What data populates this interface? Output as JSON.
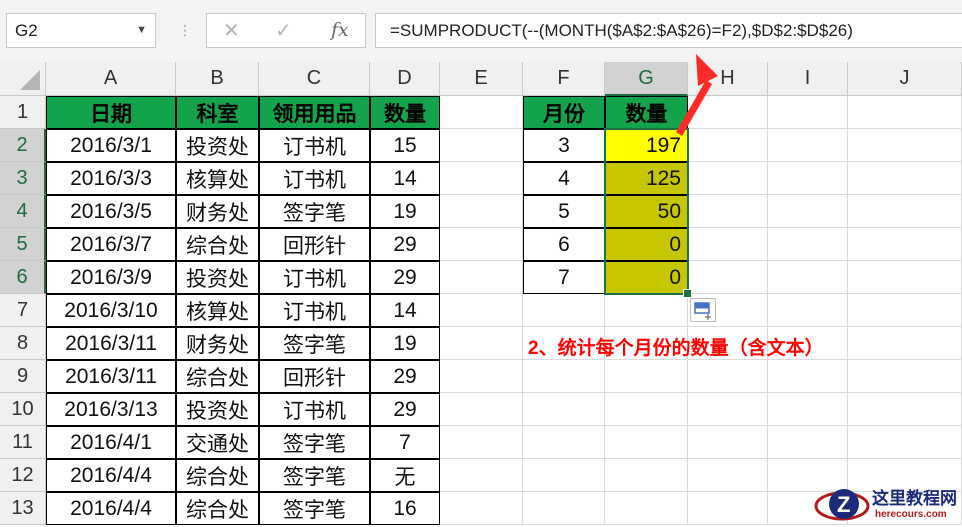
{
  "name_box": "G2",
  "formula_bar": {
    "cancel_icon": "✕",
    "enter_icon": "✓",
    "fx_label": "fx",
    "formula": "=SUMPRODUCT(--(MONTH($A$2:$A$26)=F2),$D$2:$D$26)"
  },
  "columns": [
    "A",
    "B",
    "C",
    "D",
    "E",
    "F",
    "G",
    "H",
    "I",
    "J"
  ],
  "rows": [
    "1",
    "2",
    "3",
    "4",
    "5",
    "6",
    "7",
    "8",
    "9",
    "10",
    "11",
    "12",
    "13"
  ],
  "table": {
    "headers": [
      "日期",
      "科室",
      "领用用品",
      "数量"
    ],
    "rows": [
      [
        "2016/3/1",
        "投资处",
        "订书机",
        "15"
      ],
      [
        "2016/3/3",
        "核算处",
        "订书机",
        "14"
      ],
      [
        "2016/3/5",
        "财务处",
        "签字笔",
        "19"
      ],
      [
        "2016/3/7",
        "综合处",
        "回形针",
        "29"
      ],
      [
        "2016/3/9",
        "投资处",
        "订书机",
        "29"
      ],
      [
        "2016/3/10",
        "核算处",
        "订书机",
        "14"
      ],
      [
        "2016/3/11",
        "财务处",
        "签字笔",
        "19"
      ],
      [
        "2016/3/11",
        "综合处",
        "回形针",
        "29"
      ],
      [
        "2016/3/13",
        "投资处",
        "订书机",
        "29"
      ],
      [
        "2016/4/1",
        "交通处",
        "签字笔",
        "7"
      ],
      [
        "2016/4/4",
        "综合处",
        "签字笔",
        "无"
      ],
      [
        "2016/4/4",
        "综合处",
        "签字笔",
        "16"
      ]
    ]
  },
  "summary": {
    "headers": [
      "月份",
      "数量"
    ],
    "rows": [
      [
        "3",
        "197"
      ],
      [
        "4",
        "125"
      ],
      [
        "5",
        "50"
      ],
      [
        "6",
        "0"
      ],
      [
        "7",
        "0"
      ]
    ]
  },
  "annotation": "2、统计每个月份的数量（含文本）",
  "colors": {
    "header_green": "#13a34a",
    "highlight_yellow": "#ffff00",
    "result_olive": "#c6c600",
    "arrow_red": "#ff2a2a",
    "selection_green": "#1e7145"
  },
  "watermark": {
    "title": "这里教程网",
    "url": "herecours.com"
  }
}
